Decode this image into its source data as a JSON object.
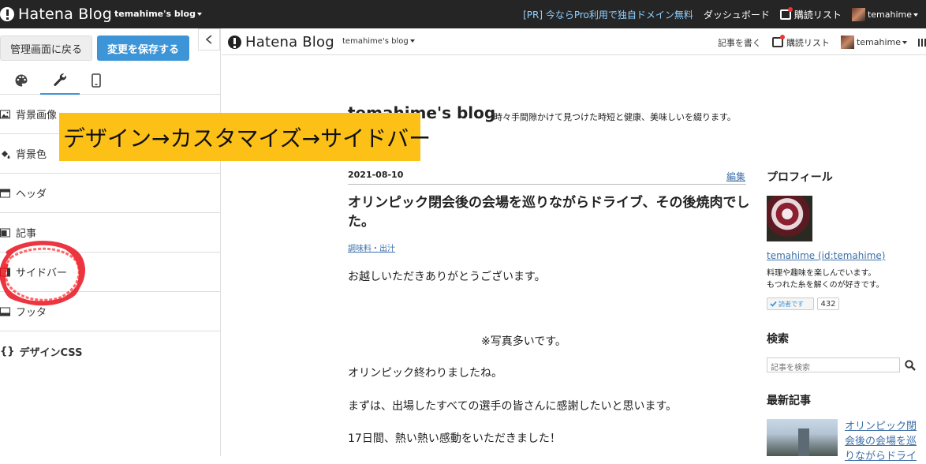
{
  "topbar": {
    "logo_text": "Hatena Blog",
    "blog_name": "temahime's blog",
    "pr_text": "[PR] 今ならPro利用で独自ドメイン無料",
    "dashboard": "ダッシュボード",
    "reading_list": "購読リスト",
    "user": "temahime"
  },
  "sidebar": {
    "back_button": "管理画面に戻る",
    "save_button": "変更を保存する",
    "tabs": [
      "palette",
      "wrench",
      "mobile"
    ],
    "items": [
      {
        "label": "背景画像",
        "icon": "image-icon"
      },
      {
        "label": "背景色",
        "icon": "paint-bucket-icon"
      },
      {
        "label": "ヘッダ",
        "icon": "layout-icon"
      },
      {
        "label": "記事",
        "icon": "layout-icon"
      },
      {
        "label": "サイドバー",
        "icon": "layout-icon"
      },
      {
        "label": "フッタ",
        "icon": "layout-icon"
      },
      {
        "label": "デザインCSS",
        "icon": "braces-icon"
      }
    ]
  },
  "overlay": {
    "text": "デザイン→カスタマイズ→サイドバー",
    "color": "#fcc016"
  },
  "preview": {
    "header": {
      "logo_text": "Hatena Blog",
      "blog_name": "temahime's blog",
      "write": "記事を書く",
      "reading_list": "購読リスト",
      "user": "temahime"
    },
    "blog_title": "temahime's blog",
    "blog_description": "時々手間隙かけて見つけた時短と健康、美味しいを綴ります。",
    "post": {
      "date": "2021-08-10",
      "edit": "編集",
      "title": "オリンピック閉会後の会場を巡りながらドライブ、その後焼肉でした。",
      "category": "調味料・出汁",
      "paragraphs": [
        "お越しいただきありがとうございます。",
        "※写真多いです。",
        "オリンピック終わりましたね。",
        "まずは、出場したすべての選手の皆さんに感謝したいと思います。",
        "17日間、熱い熱い感動をいただきました！"
      ]
    },
    "side": {
      "profile_heading": "プロフィール",
      "profile_link": "temahime (id:temahime)",
      "profile_desc_1": "料理や趣味を楽しんでいます。",
      "profile_desc_2": "もつれた糸を解くのが好きです。",
      "reader_button": "読者です",
      "reader_count": "432",
      "search_heading": "検索",
      "search_placeholder": "記事を検索",
      "recent_heading": "最新記事",
      "recent_link": "オリンピック閉会後の会場を巡りながらドライ"
    }
  },
  "colors": {
    "topbar_bg": "#252525",
    "accent": "#3d95d8",
    "link": "#3d6fa8",
    "annotation": "#e8121e"
  }
}
